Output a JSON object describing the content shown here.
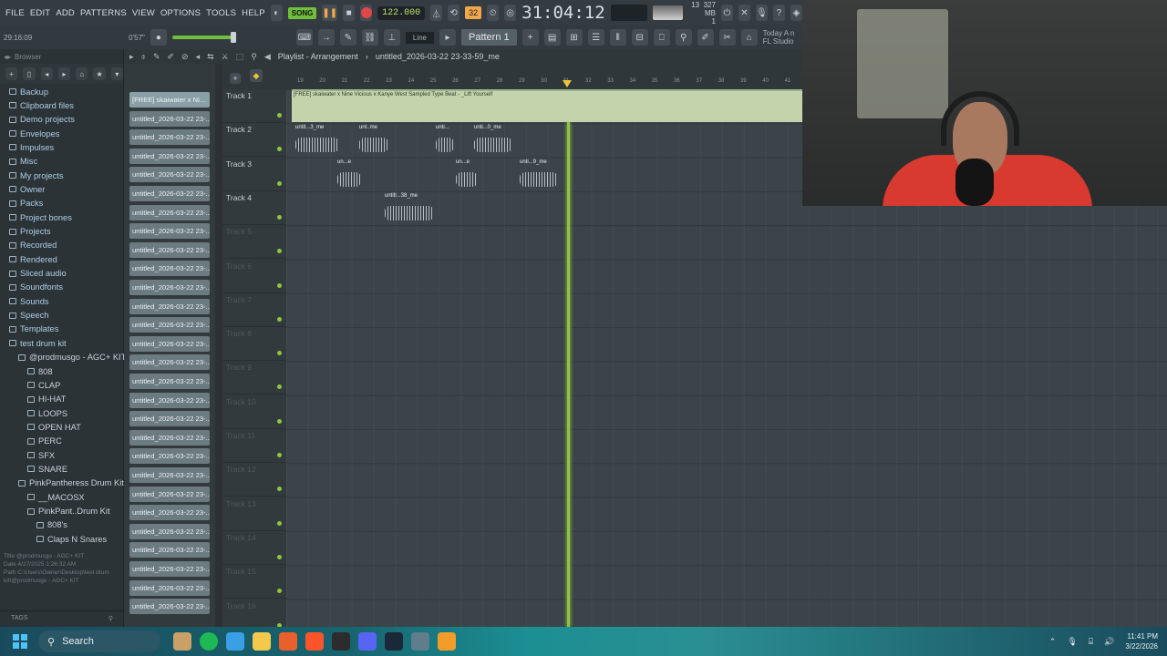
{
  "menu": [
    "FILE",
    "EDIT",
    "ADD",
    "PATTERNS",
    "VIEW",
    "OPTIONS",
    "TOOLS",
    "HELP"
  ],
  "transport": {
    "song_label": "SONG",
    "bpm": "122.000",
    "time": "31:04:12",
    "step_label": "32",
    "cpu_top": "13",
    "mem": "327 MB",
    "cpu_bottom": "1"
  },
  "toolbar2": {
    "elapsed": "29:16:09",
    "time_small": "0'57\"",
    "snap": "Line",
    "pattern": "Pattern 1",
    "news_line1": "Today A n",
    "news_line2": "FL Studio"
  },
  "browser": {
    "title": "Browser",
    "items": [
      {
        "label": "Backup",
        "level": 0
      },
      {
        "label": "Clipboard files",
        "level": 0
      },
      {
        "label": "Demo projects",
        "level": 0
      },
      {
        "label": "Envelopes",
        "level": 0
      },
      {
        "label": "Impulses",
        "level": 0
      },
      {
        "label": "Misc",
        "level": 0
      },
      {
        "label": "My projects",
        "level": 0
      },
      {
        "label": "Owner",
        "level": 0
      },
      {
        "label": "Packs",
        "level": 0
      },
      {
        "label": "Project bones",
        "level": 0
      },
      {
        "label": "Projects",
        "level": 0
      },
      {
        "label": "Recorded",
        "level": 0
      },
      {
        "label": "Rendered",
        "level": 0
      },
      {
        "label": "Sliced audio",
        "level": 0
      },
      {
        "label": "Soundfonts",
        "level": 0
      },
      {
        "label": "Sounds",
        "level": 0
      },
      {
        "label": "Speech",
        "level": 0
      },
      {
        "label": "Templates",
        "level": 0
      },
      {
        "label": "test drum kit",
        "level": 0
      },
      {
        "label": "@prodmusgo - AGC+ KIT",
        "level": 1
      },
      {
        "label": "808",
        "level": 2
      },
      {
        "label": "CLAP",
        "level": 2
      },
      {
        "label": "HI-HAT",
        "level": 2
      },
      {
        "label": "LOOPS",
        "level": 2
      },
      {
        "label": "OPEN HAT",
        "level": 2
      },
      {
        "label": "PERC",
        "level": 2
      },
      {
        "label": "SFX",
        "level": 2
      },
      {
        "label": "SNARE",
        "level": 2
      },
      {
        "label": "PinkPantheress Drum Kit",
        "level": 1
      },
      {
        "label": "__MACOSX",
        "level": 2
      },
      {
        "label": "PinkPant..Drum Kit",
        "level": 2
      },
      {
        "label": "808's",
        "level": 3
      },
      {
        "label": "Claps N Snares",
        "level": 3
      }
    ],
    "info_title": "Title  @prodmusgo - AGC+ KIT",
    "info_date": "Date  4/27/2025 1:26:32 AM",
    "info_path": "Path  C:\\Users\\Owner\\Desktop\\test drum kit\\@prodmusgo - AGC+ KIT",
    "tags": "TAGS"
  },
  "playlist": {
    "title": "Playlist - Arrangement",
    "project": "untitled_2026-03-22 23-33-59_me",
    "clips": [
      "[FREE] skaiwater x Ni...",
      "untitled_2026-03-22 23-...",
      "untitled_2026-03-22 23-...",
      "untitled_2026-03-22 23-...",
      "untitled_2026-03-22 23-...",
      "untitled_2026-03-22 23-...",
      "untitled_2026-03-22 23-...",
      "untitled_2026-03-22 23-...",
      "untitled_2026-03-22 23-...",
      "untitled_2026-03-22 23-...",
      "untitled_2026-03-22 23-...",
      "untitled_2026-03-22 23-...",
      "untitled_2026-03-22 23-...",
      "untitled_2026-03-22 23-...",
      "untitled_2026-03-22 23-...",
      "untitled_2026-03-22 23-...",
      "untitled_2026-03-22 23-...",
      "untitled_2026-03-22 23-...",
      "untitled_2026-03-22 23-...",
      "untitled_2026-03-22 23-...",
      "untitled_2026-03-22 23-...",
      "untitled_2026-03-22 23-...",
      "untitled_2026-03-22 23-...",
      "untitled_2026-03-22 23-...",
      "untitled_2026-03-22 23-...",
      "untitled_2026-03-22 23-...",
      "untitled_2026-03-22 23-...",
      "untitled_2026-03-22 23-..."
    ],
    "tracks": [
      "Track 1",
      "Track 2",
      "Track 3",
      "Track 4",
      "Track 5",
      "Track 6",
      "Track 7",
      "Track 8",
      "Track 9",
      "Track 10",
      "Track 11",
      "Track 12",
      "Track 13",
      "Track 14",
      "Track 15",
      "Track 16"
    ],
    "ruler": [
      "19",
      "20",
      "21",
      "22",
      "23",
      "24",
      "25",
      "26",
      "27",
      "28",
      "29",
      "30",
      "31",
      "32",
      "33",
      "34",
      "35",
      "36",
      "37",
      "38",
      "39",
      "40",
      "41"
    ],
    "long_clip_label": "[FREE] skaiwater x Nine Vicious x Kanye West Sampled Type Beat - _Lift Yourself",
    "short_clips": [
      {
        "label": "untit...3_me"
      },
      {
        "label": "unt..me"
      },
      {
        "label": "unti..."
      },
      {
        "label": "unti...0_me"
      },
      {
        "label": "un...e"
      },
      {
        "label": "un...e"
      },
      {
        "label": "unti...9_me"
      },
      {
        "label": "untitl...38_me"
      }
    ]
  },
  "taskbar": {
    "search": "Search",
    "time": "11:41 PM",
    "date": "3/22/2026"
  },
  "colors": {
    "accent": "#8cc63f",
    "clip": "#6b7b80",
    "webcam_shirt": "#d93a30"
  }
}
